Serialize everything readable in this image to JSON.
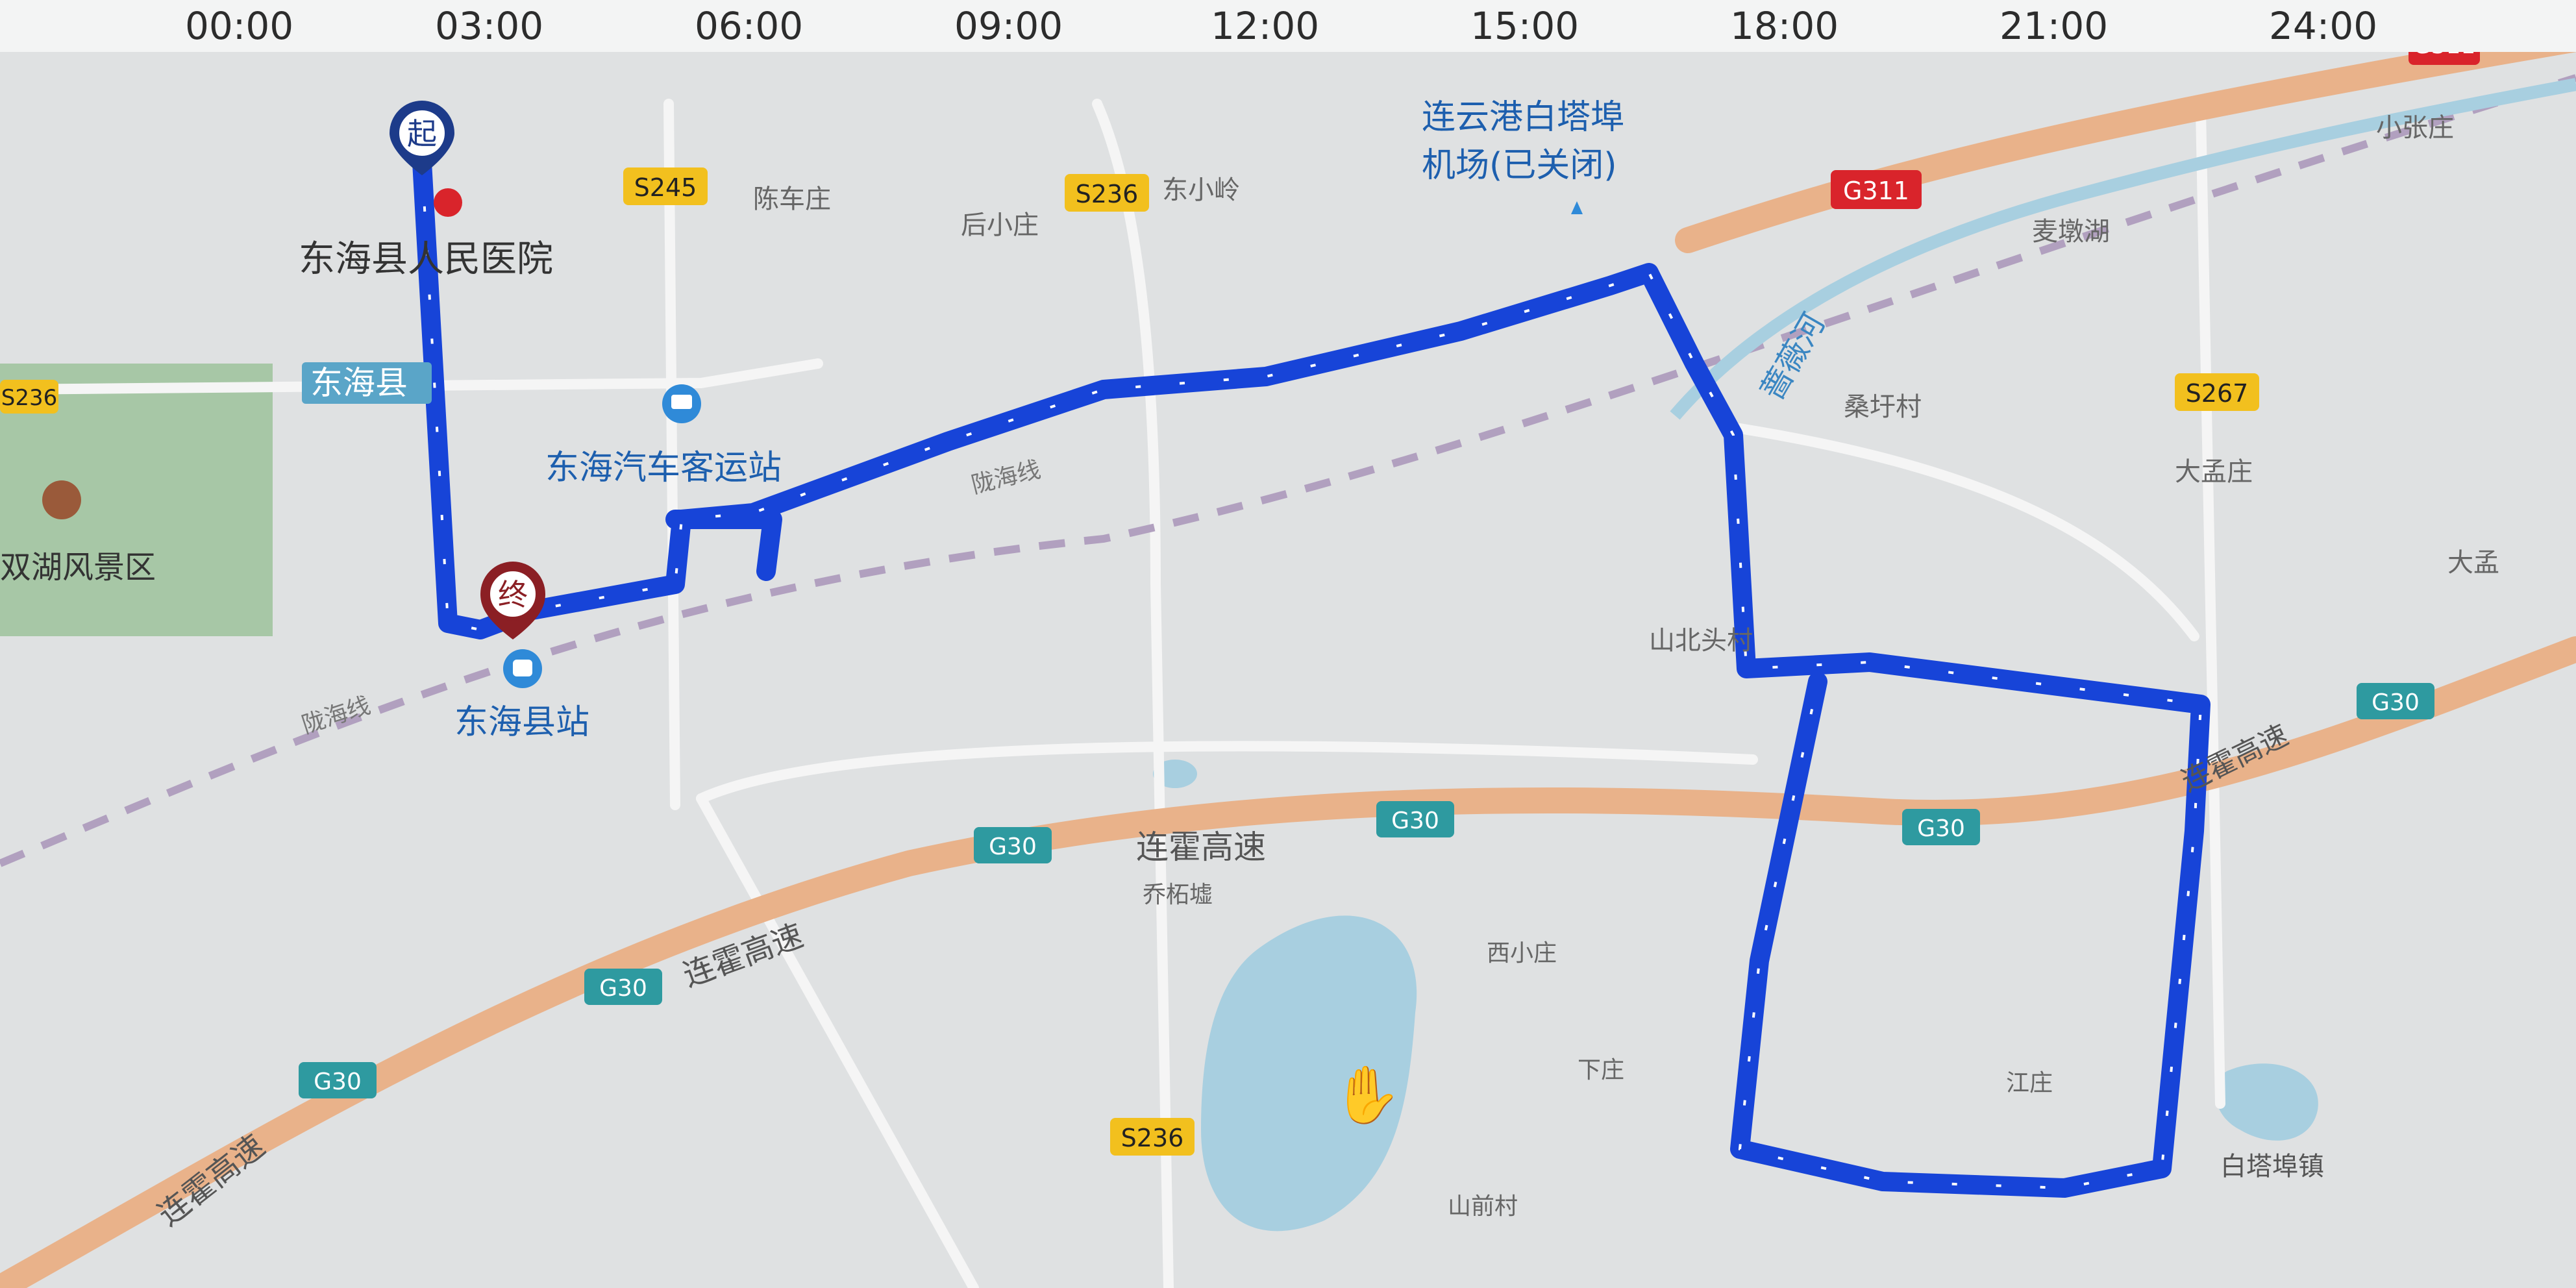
{
  "timeline": {
    "ticks": [
      "00:00",
      "03:00",
      "06:00",
      "09:00",
      "12:00",
      "15:00",
      "18:00",
      "21:00",
      "24:00"
    ]
  },
  "markers": {
    "start": "起",
    "end": "终"
  },
  "places": {
    "hospital": "东海县人民医院",
    "county": "东海县",
    "bus_station": "东海汽车客运站",
    "train_station": "东海县站",
    "airport_line1": "连云港白塔埠",
    "airport_line2": "机场(已关闭)",
    "scenic": "双湖风景区",
    "chenchezhuang": "陈车庄",
    "houxiaozhuang": "后小庄",
    "dongxiaoling": "东小岭",
    "maiduohu": "麦墩湖",
    "xiaozhangzhuang": "小张庄",
    "sangyucun": "桑圩村",
    "dameng1": "大孟庄",
    "dameng2": "大孟",
    "shanbeicun": "山北头村",
    "liangxiagaosu1": "连霍高速",
    "liangxiagaosu2": "连霍高速",
    "liangxiagaosu3": "连霍高速",
    "liangxiagaosu4": "连霍高速",
    "qiaoshan": "乔柘墟",
    "xixiaozhuang": "西小庄",
    "xiazhuang": "下庄",
    "shanqiancun": "山前村",
    "jiangjia": "江庄",
    "rail_name1": "陇海线",
    "rail_name2": "陇海线",
    "river": "蔷薇河",
    "baitabu": "白塔埠镇"
  },
  "roads": {
    "S236": "S236",
    "S245": "S245",
    "S267": "S267",
    "G311": "G311",
    "G30": "G30"
  },
  "colors": {
    "route": "#1744d8",
    "highway": "#e9b28a",
    "shield_green": "#2e9aa0",
    "shield_red": "#d9242b",
    "shield_yellow": "#f2c01e",
    "water": "#a8cfe0",
    "park": "#9dc29b",
    "rail": "#b1a0bf"
  },
  "icons": [
    "start-marker-icon",
    "end-marker-icon",
    "hospital-icon",
    "bus-icon",
    "train-station-icon",
    "airport-icon",
    "scenic-icon",
    "hand-cursor-icon"
  ]
}
